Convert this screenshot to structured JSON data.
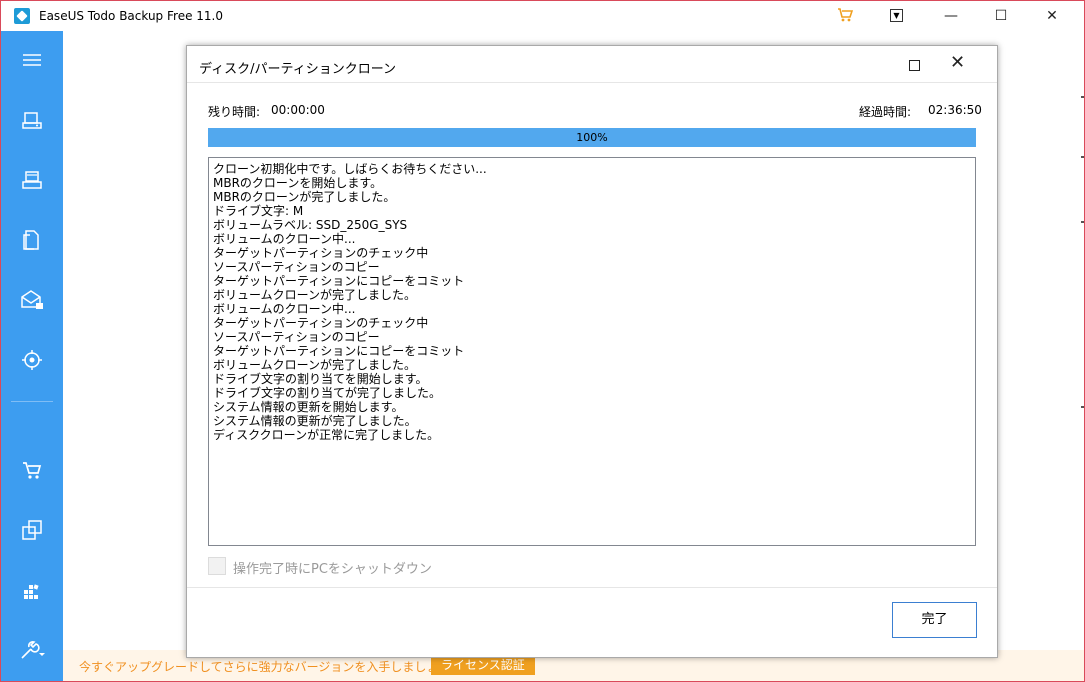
{
  "app": {
    "title": "EaseUS Todo Backup Free 11.0",
    "controls": {
      "minimize": "—",
      "maximize": "☐",
      "close": "✕"
    }
  },
  "sidebar": {
    "items": [
      {
        "icon": "menu-icon"
      },
      {
        "icon": "disk-backup-icon"
      },
      {
        "icon": "system-backup-icon"
      },
      {
        "icon": "file-backup-icon"
      },
      {
        "icon": "mail-backup-icon"
      },
      {
        "icon": "smart-backup-icon"
      },
      {
        "icon": "cart-icon"
      },
      {
        "icon": "clone-icon"
      },
      {
        "icon": "tools-icon"
      },
      {
        "icon": "settings-wrench-icon"
      }
    ]
  },
  "dialog": {
    "title": "ディスク/パーティションクローン",
    "remaining_label": "残り時間:",
    "remaining_value": "00:00:00",
    "elapsed_label": "経過時間:",
    "elapsed_value": "02:36:50",
    "progress_percent": 100,
    "progress_text": "100%",
    "log": [
      "クローン初期化中です。しばらくお待ちください...",
      "MBRのクローンを開始します。",
      "MBRのクローンが完了しました。",
      "ドライブ文字: M",
      "ボリュームラベル: SSD_250G_SYS",
      "ボリュームのクローン中...",
      "ターゲットパーティションのチェック中",
      "ソースパーティションのコピー",
      "ターゲットパーティションにコピーをコミット",
      "ボリュームクローンが完了しました。",
      "ボリュームのクローン中...",
      "ターゲットパーティションのチェック中",
      "ソースパーティションのコピー",
      "ターゲットパーティションにコピーをコミット",
      "ボリュームクローンが完了しました。",
      "ドライブ文字の割り当てを開始します。",
      "ドライブ文字の割り当てが完了しました。",
      "システム情報の更新を開始します。",
      "システム情報の更新が完了しました。",
      "ディスククローンが正常に完了しました。"
    ],
    "shutdown_label": "操作完了時にPCをシャットダウン",
    "shutdown_checked": false,
    "done_button": "完了"
  },
  "promo": {
    "text": "今すぐアップグレードしてさらに強力なバージョンを入手しましょう。",
    "button": "ライセンス認証"
  },
  "colors": {
    "sidebar": "#3d9df0",
    "progress": "#52a8ee",
    "promo_accent": "#f0a020"
  }
}
